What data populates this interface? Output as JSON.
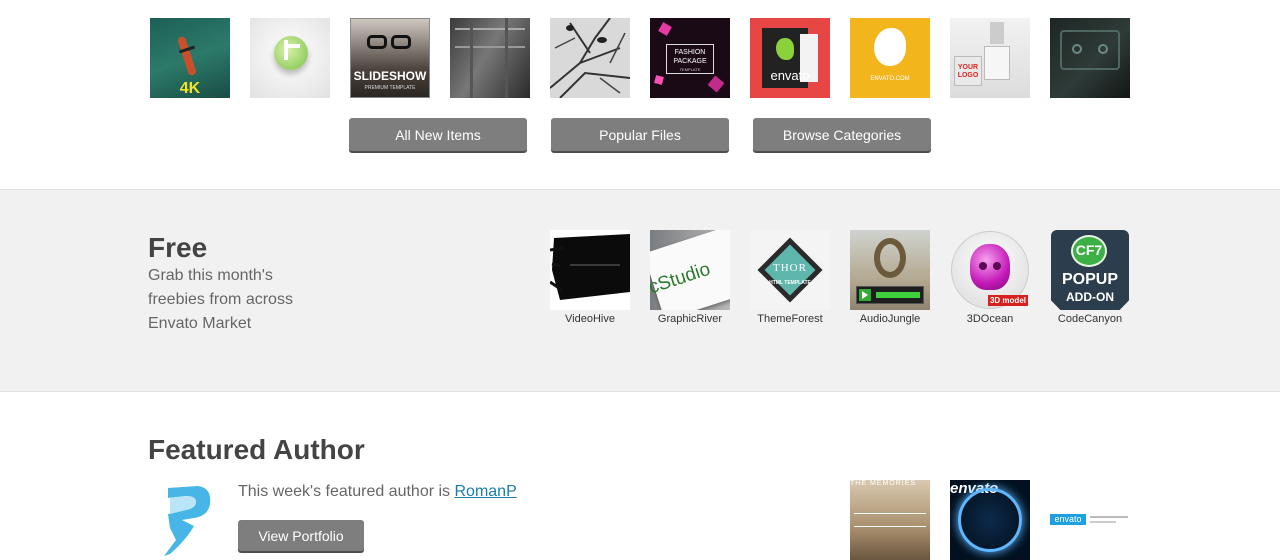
{
  "top_thumbs": [
    {
      "name": "kayak-4k",
      "caption": "4K"
    },
    {
      "name": "logo-reveal-green",
      "caption": ""
    },
    {
      "name": "slideshow-template",
      "caption": "SLIDESHOW",
      "subcaption": "PREMIUM TEMPLATE"
    },
    {
      "name": "industrial-interior",
      "caption": ""
    },
    {
      "name": "birds-branches",
      "caption": ""
    },
    {
      "name": "fashion-package",
      "caption": "FASHION PACKAGE",
      "subcaption": "TEMPLATE"
    },
    {
      "name": "envato-red",
      "caption": "envato"
    },
    {
      "name": "envato-yellow",
      "caption": "ENVATO.COM"
    },
    {
      "name": "your-logo-boxes",
      "caption": "YOUR LOGO"
    },
    {
      "name": "cassette-dark",
      "caption": ""
    }
  ],
  "buttons": {
    "all_new": "All New Items",
    "popular": "Popular Files",
    "browse": "Browse Categories"
  },
  "free": {
    "title": "Free",
    "description": "Grab this month's freebies from across Envato Market",
    "items": [
      {
        "label": "VideoHive"
      },
      {
        "label": "GraphicRiver",
        "img_text": "cStudio"
      },
      {
        "label": "ThemeForest",
        "img_text": "THOR",
        "img_sub": "HTML TEMPLATE"
      },
      {
        "label": "AudioJungle"
      },
      {
        "label": "3DOcean",
        "img_text": "3D model"
      },
      {
        "label": "CodeCanyon",
        "img_text": "CF7",
        "img_sub": "POPUP",
        "img_sub2": "ADD-ON"
      }
    ]
  },
  "featured": {
    "title": "Featured Author",
    "text": "This week's featured author is ",
    "author": "RomanP",
    "button": "View Portfolio",
    "thumbs": [
      {
        "caption": "THE MEMORIES"
      },
      {
        "caption": "envato"
      },
      {
        "caption": "envato"
      }
    ]
  },
  "colors": {
    "button_bg": "#7e7e7e",
    "band_bg": "#f1f1f1",
    "link": "#1a7dae"
  }
}
